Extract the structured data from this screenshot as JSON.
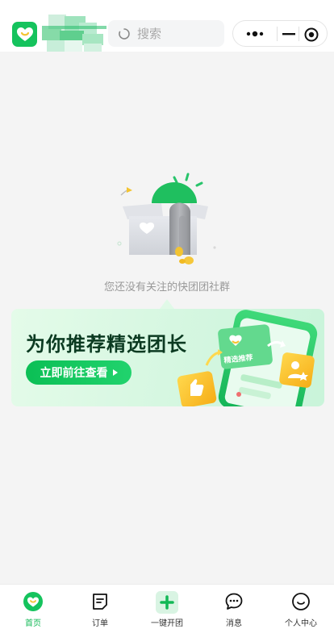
{
  "header": {
    "search_placeholder": "搜索",
    "brand_color": "#15c35d"
  },
  "empty_state": {
    "message": "您还没有关注的快团团社群"
  },
  "banner": {
    "title": "为你推荐精选团长",
    "button_label": "立即前往查看",
    "card_label": "精选推荐"
  },
  "tabbar": {
    "active_color": "#12b856",
    "items": [
      {
        "label": "首页",
        "icon": "heart-logo-icon",
        "active": true
      },
      {
        "label": "订单",
        "icon": "order-list-icon",
        "active": false
      },
      {
        "label": "一键开团",
        "icon": "plus-icon",
        "active": false
      },
      {
        "label": "消息",
        "icon": "chat-bubble-icon",
        "active": false
      },
      {
        "label": "个人中心",
        "icon": "smile-face-icon",
        "active": false
      }
    ]
  }
}
